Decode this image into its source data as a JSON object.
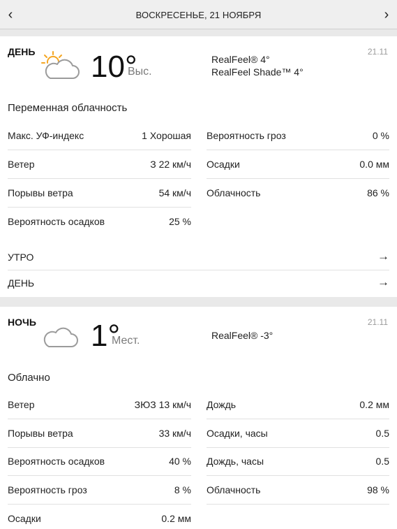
{
  "nav": {
    "prev": "‹",
    "date": "ВОСКРЕСЕНЬЕ, 21 НОЯБРЯ",
    "next": "›"
  },
  "day": {
    "title": "ДЕНЬ",
    "date": "21.11",
    "icon": "partly-cloudy-icon",
    "temp": "10°",
    "temp_label": "Выс.",
    "realfeel": "RealFeel® 4°",
    "realfeel_shade": "RealFeel Shade™ 4°",
    "phrase": "Переменная облачность",
    "left": [
      {
        "label": "Макс. УФ-индекс",
        "value": "1 Хорошая"
      },
      {
        "label": "Ветер",
        "value": "З 22 км/ч"
      },
      {
        "label": "Порывы ветра",
        "value": "54 км/ч"
      },
      {
        "label": "Вероятность осадков",
        "value": "25 %"
      }
    ],
    "right": [
      {
        "label": "Вероятность гроз",
        "value": "0 %"
      },
      {
        "label": "Осадки",
        "value": "0.0 мм"
      },
      {
        "label": "Облачность",
        "value": "86 %"
      }
    ],
    "links": [
      {
        "label": "УТРО",
        "arrow": "→"
      },
      {
        "label": "ДЕНЬ",
        "arrow": "→"
      }
    ]
  },
  "night": {
    "title": "НОЧЬ",
    "date": "21.11",
    "icon": "cloudy-icon",
    "temp": "1°",
    "temp_label": "Мест.",
    "realfeel": "RealFeel® -3°",
    "phrase": "Облачно",
    "left": [
      {
        "label": "Ветер",
        "value": "ЗЮЗ 13 км/ч"
      },
      {
        "label": "Порывы ветра",
        "value": "33 км/ч"
      },
      {
        "label": "Вероятность осадков",
        "value": "40 %"
      },
      {
        "label": "Вероятность гроз",
        "value": "8 %"
      },
      {
        "label": "Осадки",
        "value": "0.2 мм"
      }
    ],
    "right": [
      {
        "label": "Дождь",
        "value": "0.2 мм"
      },
      {
        "label": "Осадки, часы",
        "value": "0.5"
      },
      {
        "label": "Дождь, часы",
        "value": "0.5"
      },
      {
        "label": "Облачность",
        "value": "98 %"
      }
    ]
  },
  "colors": {
    "sun": "#f5a623",
    "cloud_stroke": "#9b9b9b",
    "background": "#e9e9e9"
  }
}
